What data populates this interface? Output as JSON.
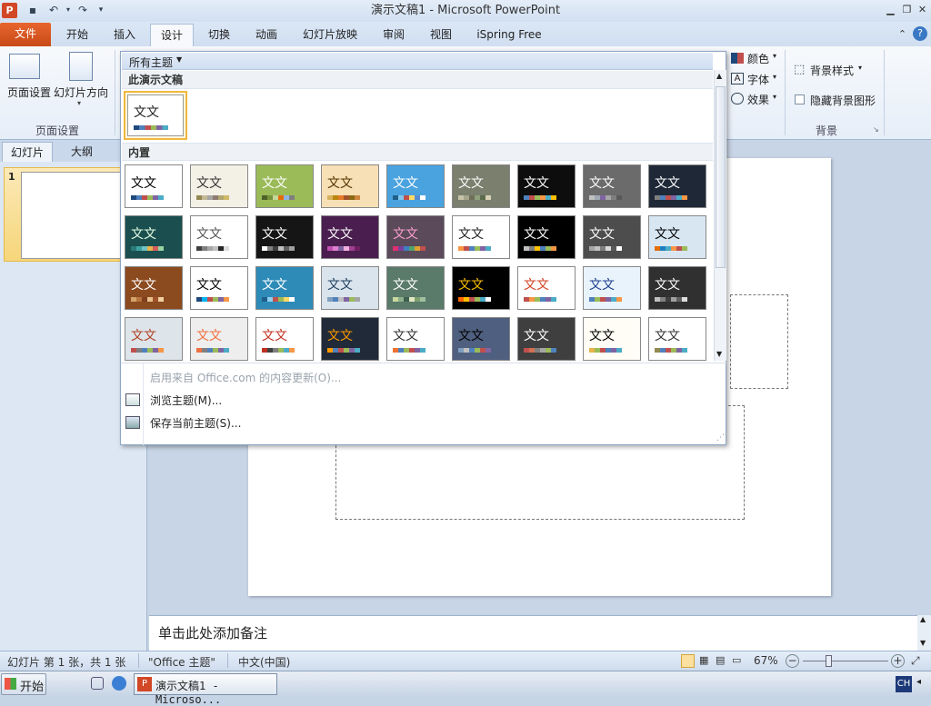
{
  "titlebar": {
    "title": "演示文稿1 - Microsoft PowerPoint",
    "app_icon": "P"
  },
  "tabs": [
    {
      "label": "文件"
    },
    {
      "label": "开始"
    },
    {
      "label": "插入"
    },
    {
      "label": "设计"
    },
    {
      "label": "切换"
    },
    {
      "label": "动画"
    },
    {
      "label": "幻灯片放映"
    },
    {
      "label": "审阅"
    },
    {
      "label": "视图"
    },
    {
      "label": "iSpring Free"
    }
  ],
  "ribbon": {
    "page_setup": "页面设置",
    "slide_orientation": "幻灯片方向",
    "group_page_setup": "页面设置",
    "colors": "颜色",
    "fonts": "字体",
    "effects": "效果",
    "background_styles": "背景样式",
    "hide_bg": "隐藏背景图形",
    "group_background": "背景"
  },
  "leftpane": {
    "tab_slides": "幻灯片",
    "tab_outline": "大纲",
    "slide_number": "1"
  },
  "gallery": {
    "filter": "所有主题",
    "section_this": "此演示文稿",
    "section_builtin": "内置",
    "theme_text": "文文",
    "menu_update": "启用来自 Office.com 的内容更新(O)...",
    "menu_browse": "浏览主题(M)...",
    "menu_save": "保存当前主题(S)..."
  },
  "notes": {
    "placeholder": "单击此处添加备注"
  },
  "status": {
    "slide_info": "幻灯片 第 1 张，共 1 张",
    "theme": "\"Office 主题\"",
    "language": "中文(中国)",
    "zoom": "67%"
  },
  "taskbar": {
    "start": "开始",
    "window": "演示文稿1 - Microso...",
    "ime": "CH"
  },
  "themes": [
    {
      "bg": "#ffffff",
      "fg": "#000000",
      "sw": [
        "#1f497d",
        "#4f81bd",
        "#c0504d",
        "#9bbb59",
        "#8064a2",
        "#4bacc6"
      ]
    },
    {
      "bg": "#f3f0e6",
      "fg": "#333333",
      "sw": [
        "#938953",
        "#c3b996",
        "#a5a5a5",
        "#8c7b70",
        "#b0a670",
        "#ceb966"
      ]
    },
    {
      "bg": "#9bbb59",
      "fg": "#ffffff",
      "sw": [
        "#4e6128",
        "#76923c",
        "#c3d69b",
        "#e36c09",
        "#8db3e2",
        "#7f7f7f"
      ]
    },
    {
      "bg": "#f7e0b5",
      "fg": "#553300",
      "sw": [
        "#d8b25c",
        "#b8860b",
        "#e57a2a",
        "#a0522d",
        "#8b6914",
        "#cd853f"
      ]
    },
    {
      "bg": "#4aa3df",
      "fg": "#ffffff",
      "sw": [
        "#1f5f8b",
        "#7fc7ef",
        "#c0504d",
        "#ffd966",
        "#548dd4",
        "#ffffff"
      ]
    },
    {
      "bg": "#7a7f6e",
      "fg": "#ffffff",
      "sw": [
        "#c6c3a8",
        "#a7a58c",
        "#6f6f5a",
        "#90a07d",
        "#5c6b4c",
        "#d7d2b5"
      ]
    },
    {
      "bg": "#0d0d0d",
      "fg": "#ffffff",
      "sw": [
        "#4f81bd",
        "#c0504d",
        "#9bbb59",
        "#f79646",
        "#4bacc6",
        "#ffc000"
      ]
    },
    {
      "bg": "#6b6b6b",
      "fg": "#ffffff",
      "sw": [
        "#c0c0c0",
        "#9fa8b4",
        "#8064a2",
        "#a5a5a5",
        "#7f7f7f",
        "#595959"
      ]
    },
    {
      "bg": "#1f2837",
      "fg": "#ffffff",
      "sw": [
        "#7f7f7f",
        "#4f81bd",
        "#c0504d",
        "#8064a2",
        "#4bacc6",
        "#f79646"
      ]
    },
    {
      "bg": "#1b4f4f",
      "fg": "#e6ffe6",
      "sw": [
        "#2a7a7a",
        "#3fa3a3",
        "#6fc3c3",
        "#e8b44c",
        "#d45d5d",
        "#9ad4a4"
      ]
    },
    {
      "bg": "#ffffff",
      "fg": "#555555",
      "sw": [
        "#404040",
        "#7f7f7f",
        "#a5a5a5",
        "#c0c0c0",
        "#262626",
        "#dcdcdc"
      ]
    },
    {
      "bg": "#151515",
      "fg": "#ffffff",
      "sw": [
        "#ffffff",
        "#808080",
        "#404040",
        "#c0c0c0",
        "#606060",
        "#a0a0a0"
      ]
    },
    {
      "bg": "#4a1f4f",
      "fg": "#ffffff",
      "sw": [
        "#c050b0",
        "#e080d0",
        "#8064a2",
        "#f0b0e0",
        "#a04090",
        "#702060"
      ]
    },
    {
      "bg": "#5a4a5a",
      "fg": "#ff9ecf",
      "sw": [
        "#e0306f",
        "#7a3f9a",
        "#3f7fbf",
        "#4fa36f",
        "#e0a030",
        "#c0504d"
      ]
    },
    {
      "bg": "#ffffff",
      "fg": "#222222",
      "sw": [
        "#f79646",
        "#c0504d",
        "#4f81bd",
        "#9bbb59",
        "#8064a2",
        "#4bacc6"
      ]
    },
    {
      "bg": "#000000",
      "fg": "#ffffff",
      "sw": [
        "#c0c0c0",
        "#808080",
        "#ffc000",
        "#4f81bd",
        "#9bbb59",
        "#f79646"
      ]
    },
    {
      "bg": "#4d4d4d",
      "fg": "#ffffff",
      "sw": [
        "#a5a5a5",
        "#c0c0c0",
        "#7f7f7f",
        "#d9d9d9",
        "#595959",
        "#ffffff"
      ]
    },
    {
      "bg": "#d8e6f2",
      "fg": "#000000",
      "sw": [
        "#e36c09",
        "#1f7fbf",
        "#4bacc6",
        "#f79646",
        "#c0504d",
        "#9bbb59"
      ]
    },
    {
      "bg": "#8c4a1f",
      "fg": "#ffffff",
      "sw": [
        "#d4a36a",
        "#b8733f",
        "#7f3f1f",
        "#e8c08a",
        "#a0522d",
        "#f0d0a0"
      ]
    },
    {
      "bg": "#ffffff",
      "fg": "#000000",
      "sw": [
        "#1f497d",
        "#00b0f0",
        "#c0504d",
        "#9bbb59",
        "#8064a2",
        "#f79646"
      ]
    },
    {
      "bg": "#2e8bb8",
      "fg": "#ffffff",
      "sw": [
        "#1f5f8b",
        "#8fd0ef",
        "#c0504d",
        "#9bbb59",
        "#ffd966",
        "#ffffff"
      ]
    },
    {
      "bg": "#d9e4ec",
      "fg": "#1f3f5f",
      "sw": [
        "#7f9fbf",
        "#4f81bd",
        "#c0c0c0",
        "#8064a2",
        "#9bbb59",
        "#a5a5a5"
      ]
    },
    {
      "bg": "#5a7a6a",
      "fg": "#ffffff",
      "sw": [
        "#c8d8a0",
        "#8fb08a",
        "#3f5f4f",
        "#e0e8c0",
        "#7f9f6f",
        "#a0c0a0"
      ]
    },
    {
      "bg": "#000000",
      "fg": "#ffc000",
      "sw": [
        "#ff6600",
        "#ffc000",
        "#c0504d",
        "#9bbb59",
        "#4bacc6",
        "#ffffff"
      ]
    },
    {
      "bg": "#ffffff",
      "fg": "#d04020",
      "sw": [
        "#c0504d",
        "#f79646",
        "#9bbb59",
        "#4f81bd",
        "#8064a2",
        "#4bacc6"
      ]
    },
    {
      "bg": "#e8f3fb",
      "fg": "#1f3f8f",
      "sw": [
        "#4f81bd",
        "#9bbb59",
        "#c0504d",
        "#8064a2",
        "#4bacc6",
        "#f79646"
      ]
    },
    {
      "bg": "#303030",
      "fg": "#ffffff",
      "sw": [
        "#c0c0c0",
        "#808080",
        "#404040",
        "#a0a0a0",
        "#606060",
        "#e0e0e0"
      ]
    },
    {
      "bg": "#dde4ea",
      "fg": "#b04020",
      "sw": [
        "#c0504d",
        "#7f7f7f",
        "#4f81bd",
        "#9bbb59",
        "#8064a2",
        "#f79646"
      ]
    },
    {
      "bg": "#eeeeee",
      "fg": "#f07040",
      "sw": [
        "#f07040",
        "#7f7f7f",
        "#4f81bd",
        "#9bbb59",
        "#8064a2",
        "#4bacc6"
      ]
    },
    {
      "bg": "#ffffff",
      "fg": "#c03020",
      "sw": [
        "#c03020",
        "#404040",
        "#7f7f7f",
        "#9bbb59",
        "#4bacc6",
        "#f79646"
      ]
    },
    {
      "bg": "#202a38",
      "fg": "#ff9900",
      "sw": [
        "#ff9900",
        "#4f81bd",
        "#c0504d",
        "#9bbb59",
        "#8064a2",
        "#4bacc6"
      ]
    },
    {
      "bg": "#ffffff",
      "fg": "#333333",
      "sw": [
        "#f07030",
        "#4f81bd",
        "#9bbb59",
        "#c0504d",
        "#8064a2",
        "#4bacc6"
      ]
    },
    {
      "bg": "#4f5f7f",
      "fg": "#000000",
      "sw": [
        "#7f9fbf",
        "#c0c0c0",
        "#4f81bd",
        "#9bbb59",
        "#c0504d",
        "#8064a2"
      ]
    },
    {
      "bg": "#3f3f3f",
      "fg": "#ffffff",
      "sw": [
        "#c0504d",
        "#d07050",
        "#7f7f7f",
        "#a5a5a5",
        "#9bbb59",
        "#4f81bd"
      ]
    },
    {
      "bg": "#fffdf5",
      "fg": "#000000",
      "sw": [
        "#e8b44c",
        "#9bbb59",
        "#c0504d",
        "#4f81bd",
        "#8064a2",
        "#4bacc6"
      ]
    },
    {
      "bg": "#ffffff",
      "fg": "#333333",
      "sw": [
        "#938953",
        "#4f81bd",
        "#c0504d",
        "#9bbb59",
        "#8064a2",
        "#4bacc6"
      ]
    }
  ]
}
